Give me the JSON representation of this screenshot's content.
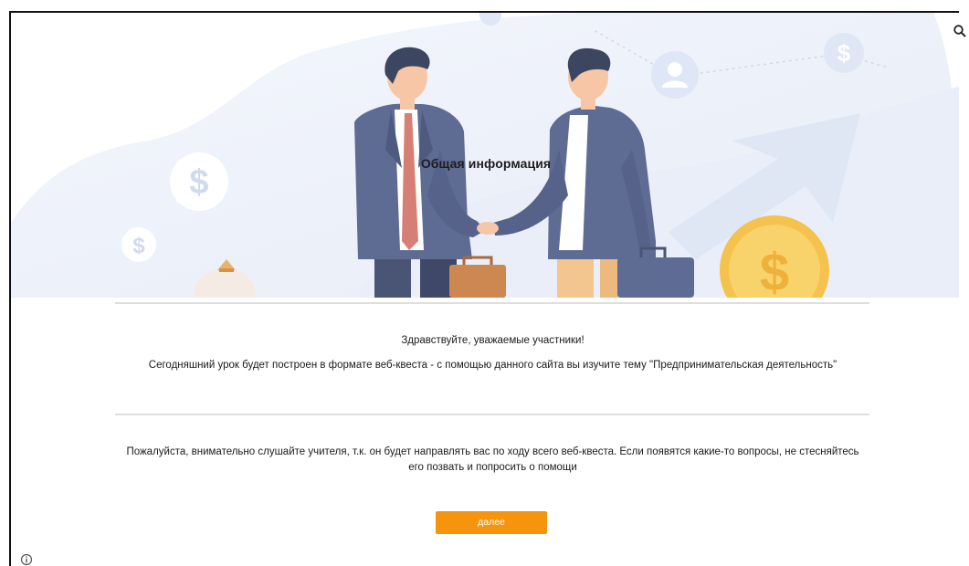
{
  "hero": {
    "title": "Общая информация",
    "icons": [
      "dollar-coin-icon",
      "user-icon",
      "money-bag-icon",
      "trend-arrow-icon",
      "gold-coin-icon"
    ]
  },
  "toolbar": {
    "search_icon": "search-icon"
  },
  "content": {
    "greeting": "Здравствуйте, уважаемые участники!",
    "intro": "Сегодняшний урок будет построен в формате веб-квеста - с помощью данного сайта вы изучите тему \"Предпринимательская деятельность\"",
    "note": "Пожалуйста, внимательно слушайте учителя, т.к. он будет направлять вас по ходу всего веб-квеста. Если появятся какие-то вопросы, не стесняйтесь его позвать и попросить о помощи"
  },
  "actions": {
    "next_label": "далее"
  },
  "footer": {
    "info_icon": "info-icon"
  },
  "colors": {
    "accent": "#f7940e",
    "hero_bg": "#eef2fa",
    "suit": "#5e6b93",
    "coin": "#f5c24d"
  }
}
